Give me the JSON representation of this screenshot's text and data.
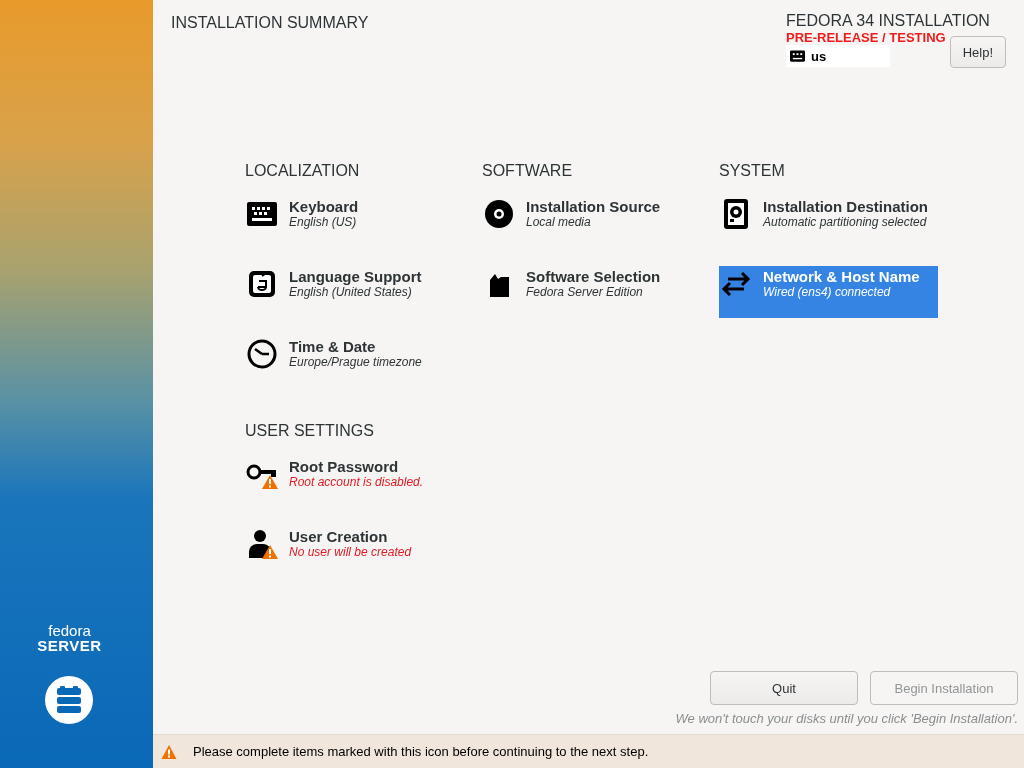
{
  "sidebar": {
    "brand": "fedora",
    "product": "SERVER"
  },
  "header": {
    "title": "INSTALLATION SUMMARY",
    "product_title": "FEDORA 34 INSTALLATION",
    "release_note": "PRE-RELEASE / TESTING",
    "keyboard_layout": "us",
    "help_button": "Help!"
  },
  "sections": [
    {
      "title": "LOCALIZATION",
      "spokes": [
        {
          "kind": "keyboard",
          "title": "Keyboard",
          "status": "English (US)",
          "warning": false,
          "selected": false
        },
        {
          "kind": "language",
          "title": "Language Support",
          "status": "English (United States)",
          "warning": false,
          "selected": false
        },
        {
          "kind": "clock",
          "title": "Time & Date",
          "status": "Europe/Prague timezone",
          "warning": false,
          "selected": false
        }
      ]
    },
    {
      "title": "SOFTWARE",
      "spokes": [
        {
          "kind": "disc",
          "title": "Installation Source",
          "status": "Local media",
          "warning": false,
          "selected": false
        },
        {
          "kind": "package",
          "title": "Software Selection",
          "status": "Fedora Server Edition",
          "warning": false,
          "selected": false
        }
      ]
    },
    {
      "title": "SYSTEM",
      "spokes": [
        {
          "kind": "disk",
          "title": "Installation Destination",
          "status": "Automatic partitioning selected",
          "warning": false,
          "selected": false
        },
        {
          "kind": "network",
          "title": "Network & Host Name",
          "status": "Wired (ens4) connected",
          "warning": false,
          "selected": true
        }
      ]
    },
    {
      "title": "USER SETTINGS",
      "spokes": [
        {
          "kind": "key",
          "title": "Root Password",
          "status": "Root account is disabled.",
          "warning": true,
          "selected": false
        },
        {
          "kind": "user",
          "title": "User Creation",
          "status": "No user will be created",
          "warning": true,
          "selected": false
        }
      ]
    }
  ],
  "buttons": [
    {
      "label": "Quit",
      "disabled": false
    },
    {
      "label": "Begin Installation",
      "disabled": true
    }
  ],
  "disk_note": "We won't touch your disks until you click 'Begin Installation'.",
  "warning_bar": {
    "text": "Please complete items marked with this icon before continuing to the next step."
  }
}
